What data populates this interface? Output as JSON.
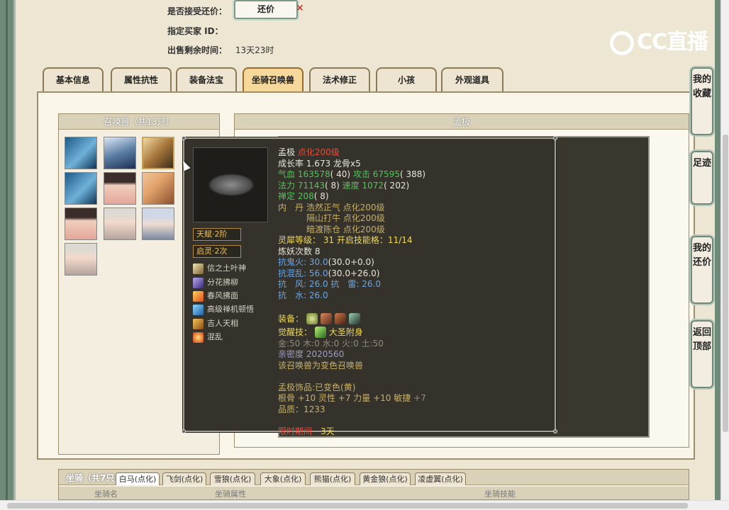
{
  "header": {
    "accept_counter_label": "是否接受还价：",
    "counter_button": "还价",
    "buyer_id_label": "指定买家 ID：",
    "buyer_id_value": "",
    "time_left_label": "出售剩余时间：",
    "time_left_value": "13天23时",
    "logo_text": "CC直播"
  },
  "tabs": [
    "基本信息",
    "属性抗性",
    "装备法宝",
    "坐骑召唤兽",
    "法术修正",
    "小孩",
    "外观道具"
  ],
  "active_tab": "坐骑召唤兽",
  "pet_list": {
    "title": "召唤兽（共13只）",
    "avatars": [
      "pet-1",
      "pet-2",
      "pet-3",
      "pet-4",
      "pet-5",
      "pet-6",
      "pet-7",
      "pet-8",
      "pet-9",
      "pet-10"
    ]
  },
  "detail_header": "孟极",
  "popup": {
    "talent_label": "天赋·2阶",
    "spirit_label": "启灵·2次",
    "skills": [
      "信之土叶神",
      "分花拂柳",
      "春风拂面",
      "高级禅机顿悟",
      "吉人天相",
      "混乱"
    ],
    "name": "孟极",
    "name_level": "点化200级",
    "growth": "成长率 1.673 龙骨x5",
    "hp_label": "气血",
    "hp_value": "163578",
    "hp_extra": "( 40)",
    "atk_label": "攻击",
    "atk_value": "67595",
    "atk_extra": "( 388)",
    "mp_label": "法力",
    "mp_value": "71143",
    "mp_extra": "( 8)",
    "spd_label": "速度",
    "spd_value": "1072",
    "spd_extra": "( 202)",
    "zen_label": "禅定",
    "zen_value": "208",
    "zen_extra": "( 8)",
    "dan_label": "内　丹",
    "dan_1": "浩然正气 点化200级",
    "dan_2": "隔山打牛 点化200级",
    "dan_3": "暗渡陈仓 点化200级",
    "soul_label": "灵犀等级：",
    "soul_value": "31 开启技能格：11/14",
    "refine": "炼妖次数 8",
    "fire_label": "抗鬼火:",
    "fire_base": "30.0",
    "fire_detail": "(30.0+0.0)",
    "chaos_label": "抗混乱:",
    "chaos_base": "56.0",
    "chaos_detail": "(30.0+26.0)",
    "wind_label": "抗　风:",
    "wind_value": "26.0",
    "thunder_label": "抗　雷:",
    "thunder_value": "26.0",
    "water_label": "抗　水:",
    "water_value": "26.0",
    "equip_label": "装备：",
    "awaken_label": "觉醒技：",
    "awaken_value": "大圣附身",
    "elements": "金:50 木:0 水:0 火:0 土:50",
    "intimacy": "亲密度 2020560",
    "transform": "该召唤兽为变色召唤兽",
    "ornament": "孟极饰品:已变色(黄)",
    "bonus_prefix": "根骨 +10 灵性 +7 力量 +10 敏捷",
    "bonus_extra": "+7",
    "quality": "品质：1233",
    "limit_label": "限时期间",
    "limit_value": "3天"
  },
  "mounts": {
    "title": "坐骑（共7只）",
    "tabs": [
      "白马(点化)",
      "飞剑(点化)",
      "雪狼(点化)",
      "大象(点化)",
      "熊猫(点化)",
      "黄金狼(点化)",
      "凌虚翼(点化)"
    ],
    "columns": [
      "坐骑名",
      "坐骑属性",
      "坐骑技能"
    ]
  },
  "side_buttons": [
    "我的收藏",
    "足迹",
    "我的还价",
    "返回顶部"
  ]
}
